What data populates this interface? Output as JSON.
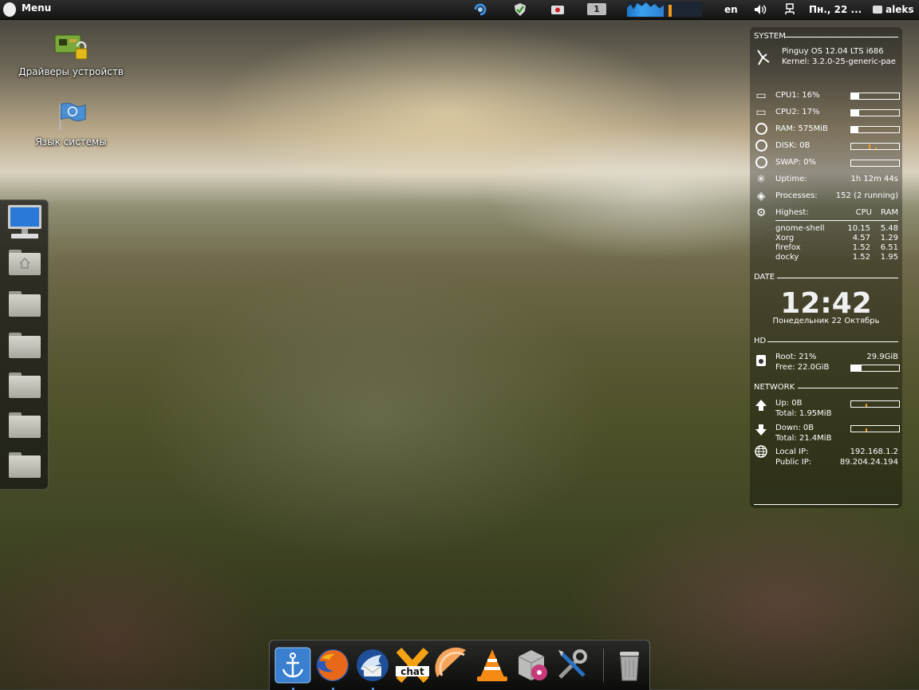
{
  "top_panel": {
    "menu_label": "Menu",
    "workspace": "1",
    "keyboard_layout": "en",
    "datetime": "Пн., 22 ...",
    "user": "aleks"
  },
  "desktop_icons": [
    {
      "label": "Драйверы устройств",
      "icon": "device-drivers-icon"
    },
    {
      "label": "Язык системы",
      "icon": "language-flag-icon"
    }
  ],
  "conky": {
    "system": {
      "header": "SYSTEM",
      "os": "Pinguy OS 12.04 LTS i686",
      "kernel": "Kernel: 3.2.0-25-generic-pae"
    },
    "stats": {
      "cpu1": {
        "label": "CPU1: 16%",
        "value": 16
      },
      "cpu2": {
        "label": "CPU2: 17%",
        "value": 17
      },
      "ram": {
        "label": "RAM: 575MiB",
        "value": 15
      },
      "disk": {
        "label": "DISK: 0B"
      },
      "swap": {
        "label": "SWAP: 0%",
        "value": 0
      },
      "uptime_label": "Uptime:",
      "uptime": "1h 12m 44s",
      "processes_label": "Processes:",
      "processes": "152 (2 running)",
      "highest_label": "Highest:",
      "col_cpu": "CPU",
      "col_ram": "RAM"
    },
    "top_processes": [
      {
        "name": "gnome-shell",
        "cpu": "10.15",
        "ram": "5.48"
      },
      {
        "name": "Xorg",
        "cpu": "4.57",
        "ram": "1.29"
      },
      {
        "name": "firefox",
        "cpu": "1.52",
        "ram": "6.51"
      },
      {
        "name": "docky",
        "cpu": "1.52",
        "ram": "1.95"
      }
    ],
    "date": {
      "header": "DATE",
      "time": "12:42",
      "day": "Понедельник 22 Октябрь"
    },
    "hd": {
      "header": "HD",
      "root": "Root: 21%",
      "total": "29.9GiB",
      "free": "Free: 22.0GiB",
      "used_percent": 21
    },
    "network": {
      "header": "NETWORK",
      "up": "Up: 0B",
      "up_total": "Total: 1.95MiB",
      "down": "Down: 0B",
      "down_total": "Total: 21.4MiB",
      "local_ip_label": "Local IP:",
      "local_ip": "192.168.1.2",
      "public_ip_label": "Public IP:",
      "public_ip": "89.204.24.194"
    }
  },
  "dock": {
    "apps": [
      {
        "name": "docky",
        "icon": "anchor-icon"
      },
      {
        "name": "firefox",
        "icon": "firefox-icon"
      },
      {
        "name": "thunderbird",
        "icon": "thunderbird-icon"
      },
      {
        "name": "xchat",
        "icon": "xchat-icon"
      },
      {
        "name": "tomboy",
        "icon": "orange-slice-icon"
      },
      {
        "name": "vlc",
        "icon": "vlc-cone-icon"
      },
      {
        "name": "software-center",
        "icon": "package-icon"
      },
      {
        "name": "settings",
        "icon": "tools-icon"
      },
      {
        "name": "trash",
        "icon": "trash-icon"
      }
    ]
  }
}
